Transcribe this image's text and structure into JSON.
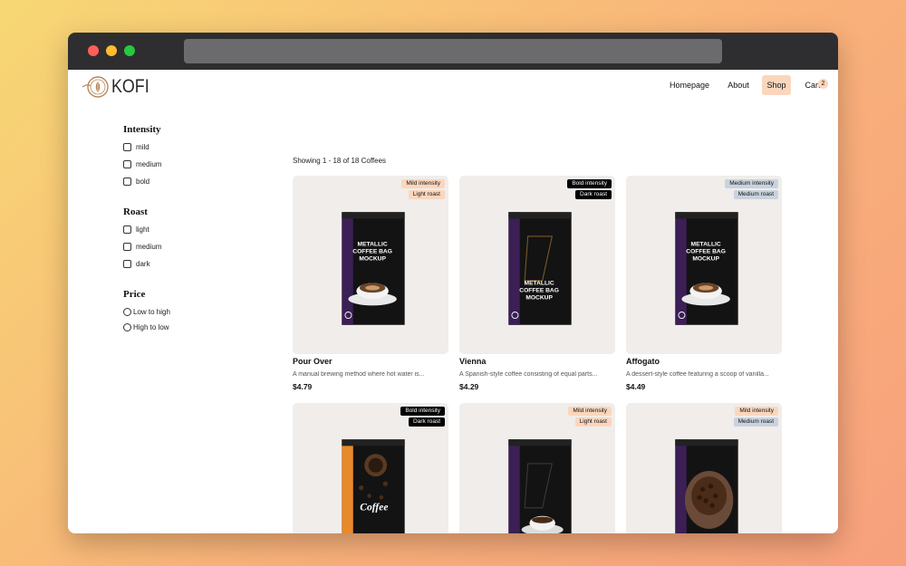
{
  "brand": {
    "name": "KOFI"
  },
  "nav": {
    "items": [
      "Homepage",
      "About",
      "Shop",
      "Cart"
    ],
    "cart_count": "2"
  },
  "filters": {
    "intensity": {
      "title": "Intensity",
      "options": [
        "mild",
        "medium",
        "bold"
      ]
    },
    "roast": {
      "title": "Roast",
      "options": [
        "light",
        "medium",
        "dark"
      ]
    },
    "price": {
      "title": "Price",
      "options": [
        "Low to high",
        "High to low"
      ]
    }
  },
  "results": {
    "showing": "Showing 1 - 18 of 18 Coffees"
  },
  "colors": {
    "mild": "#fbd6bd",
    "medium": "#c9d3de",
    "bold": "#000000",
    "light": "#fbd6bd",
    "dark": "#000000",
    "shop_active": "#fbd6bd"
  },
  "products": [
    {
      "name": "Pour Over",
      "desc": "A manual brewing method where hot water is...",
      "price": "$4.79",
      "intensity": "Mild intensity",
      "roast": "Light roast",
      "intensity_key": "mild",
      "roast_key": "light",
      "bag": "metallic-cup"
    },
    {
      "name": "Vienna",
      "desc": "A Spanish-style coffee consisting of equal parts...",
      "price": "$4.29",
      "intensity": "Bold intensity",
      "roast": "Dark roast",
      "intensity_key": "bold",
      "roast_key": "dark",
      "bag": "metallic-plain"
    },
    {
      "name": "Affogato",
      "desc": "A dessert-style coffee featuring a scoop of vanilla...",
      "price": "$4.49",
      "intensity": "Medium intensity",
      "roast": "Medium roast",
      "intensity_key": "medium",
      "roast_key": "medium",
      "bag": "metallic-cup"
    },
    {
      "name": "",
      "desc": "",
      "price": "",
      "intensity": "Bold intensity",
      "roast": "Dark roast",
      "intensity_key": "bold",
      "roast_key": "dark",
      "bag": "orange-coffee"
    },
    {
      "name": "",
      "desc": "",
      "price": "",
      "intensity": "Mild intensity",
      "roast": "Light roast",
      "intensity_key": "mild",
      "roast_key": "light",
      "bag": "black-cup"
    },
    {
      "name": "",
      "desc": "",
      "price": "",
      "intensity": "Mild intensity",
      "roast": "Medium roast",
      "intensity_key": "mild",
      "roast_key": "medium",
      "bag": "beans-hands"
    }
  ],
  "bag_text": {
    "metallic": [
      "METALLIC",
      "COFFEE BAG",
      "MOCKUP"
    ],
    "coffee": "Coffee"
  }
}
